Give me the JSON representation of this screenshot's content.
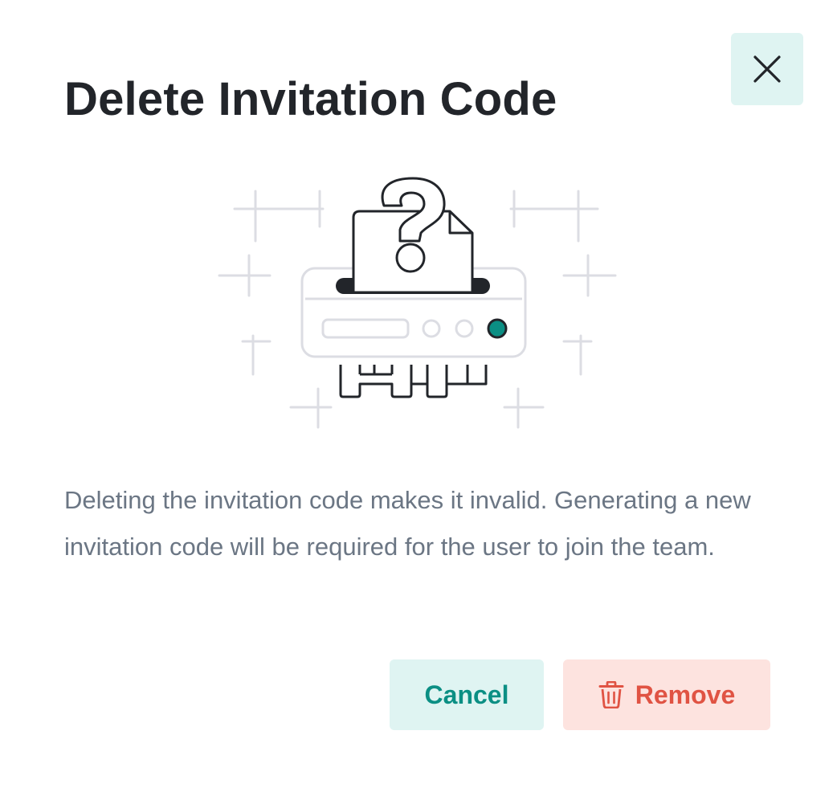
{
  "dialog": {
    "title": "Delete Invitation Code",
    "description": "Deleting the invitation code makes it invalid. Generating a new invitation code will be required for the user to join the team.",
    "close_icon": "close-icon",
    "illustration_icon": "document-shredder-question-illustration",
    "buttons": {
      "cancel_label": "Cancel",
      "remove_label": "Remove",
      "remove_icon": "trash-icon"
    }
  },
  "colors": {
    "accent": "#0b8f84",
    "accent_bg": "#dff4f2",
    "danger": "#e05343",
    "danger_bg": "#fde3df",
    "title": "#22252a",
    "body_text": "#6b7684"
  }
}
